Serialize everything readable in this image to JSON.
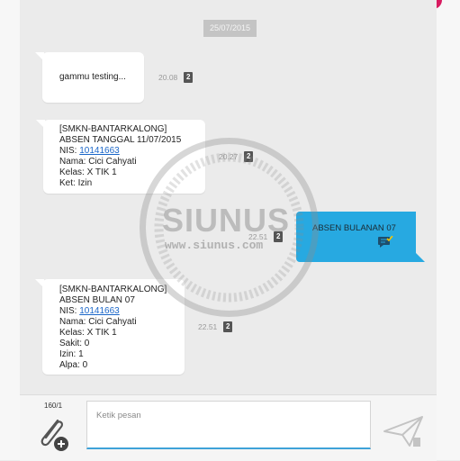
{
  "date_separator": "25/07/2015",
  "messages": [
    {
      "lines": [
        "gammu testing..."
      ],
      "time": "20.08",
      "sim": "2"
    },
    {
      "lines": [
        "[SMKN-BANTARKALONG]",
        "ABSEN TANGGAL 11/07/2015"
      ],
      "nis_label": "NIS: ",
      "nis": "10141663",
      "lines_after": [
        "Nama: Cici Cahyati",
        "Kelas: X TIK 1",
        "Ket: Izin"
      ],
      "time": "20.27",
      "sim": "2"
    },
    {
      "text": "ABSEN BULANAN 07",
      "time": "22.51",
      "sim": "2",
      "outgoing": true
    },
    {
      "lines": [
        "[SMKN-BANTARKALONG]",
        "ABSEN BULAN 07"
      ],
      "nis_label": "NIS: ",
      "nis": "10141663",
      "lines_after": [
        "Nama: Cici Cahyati",
        "Kelas: X TIK 1",
        "Sakit: 0",
        "Izin: 1",
        "Alpa: 0"
      ],
      "time": "22.51",
      "sim": "2"
    }
  ],
  "watermark": {
    "title": "SIUNUS",
    "url": "www.siunus.com"
  },
  "composer": {
    "counter": "160/1",
    "placeholder": "Ketik pesan"
  },
  "icons": {
    "attach": "paperclip-add-icon",
    "send": "send-icon",
    "sim": "sim-2-icon",
    "delivered": "delivered-icon"
  },
  "colors": {
    "outgoing_bubble": "#27a9e1",
    "input_underline": "#3ea2d8",
    "link": "#1a66c8"
  }
}
